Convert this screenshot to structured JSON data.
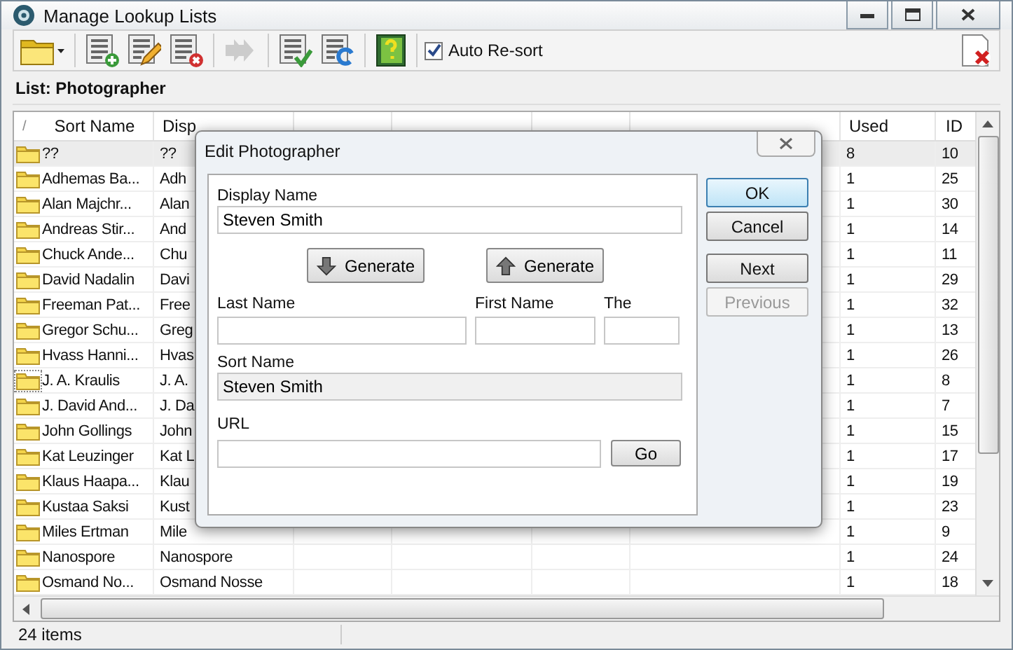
{
  "window": {
    "title": "Manage Lookup Lists"
  },
  "toolbar": {
    "auto_resort": {
      "label": "Auto Re-sort",
      "checked": true
    }
  },
  "list_label": "List: Photographer",
  "table": {
    "columns": [
      {
        "label": "/"
      },
      {
        "label": "Sort Name"
      },
      {
        "label": "Disp"
      },
      {
        "label": "Used"
      },
      {
        "label": "ID"
      }
    ],
    "rows": [
      {
        "sort_name": "??",
        "display_name": "??",
        "used": "8",
        "id": "10",
        "selected": true,
        "focused": false
      },
      {
        "sort_name": "Adhemas Ba...",
        "display_name": "Adh",
        "used": "1",
        "id": "25",
        "selected": false,
        "focused": false
      },
      {
        "sort_name": "Alan Majchr...",
        "display_name": "Alan",
        "used": "1",
        "id": "30",
        "selected": false,
        "focused": false
      },
      {
        "sort_name": "Andreas Stir...",
        "display_name": "And",
        "used": "1",
        "id": "14",
        "selected": false,
        "focused": false
      },
      {
        "sort_name": "Chuck Ande...",
        "display_name": "Chu",
        "used": "1",
        "id": "11",
        "selected": false,
        "focused": false
      },
      {
        "sort_name": "David Nadalin",
        "display_name": "Davi",
        "used": "1",
        "id": "29",
        "selected": false,
        "focused": false
      },
      {
        "sort_name": "Freeman Pat...",
        "display_name": "Free",
        "used": "1",
        "id": "32",
        "selected": false,
        "focused": false
      },
      {
        "sort_name": "Gregor Schu...",
        "display_name": "Greg",
        "used": "1",
        "id": "13",
        "selected": false,
        "focused": false
      },
      {
        "sort_name": "Hvass Hanni...",
        "display_name": "Hvas",
        "used": "1",
        "id": "26",
        "selected": false,
        "focused": false
      },
      {
        "sort_name": "J. A. Kraulis",
        "display_name": "J. A.",
        "used": "1",
        "id": "8",
        "selected": false,
        "focused": true
      },
      {
        "sort_name": "J. David And...",
        "display_name": "J. Da",
        "used": "1",
        "id": "7",
        "selected": false,
        "focused": false
      },
      {
        "sort_name": "John Gollings",
        "display_name": "John",
        "used": "1",
        "id": "15",
        "selected": false,
        "focused": false
      },
      {
        "sort_name": "Kat Leuzinger",
        "display_name": "Kat L",
        "used": "1",
        "id": "17",
        "selected": false,
        "focused": false
      },
      {
        "sort_name": "Klaus Haapa...",
        "display_name": "Klau",
        "used": "1",
        "id": "19",
        "selected": false,
        "focused": false
      },
      {
        "sort_name": "Kustaa Saksi",
        "display_name": "Kust",
        "used": "1",
        "id": "23",
        "selected": false,
        "focused": false
      },
      {
        "sort_name": "Miles Ertman",
        "display_name": "Mile",
        "used": "1",
        "id": "9",
        "selected": false,
        "focused": false
      },
      {
        "sort_name": "Nanospore",
        "display_name": "Nanospore",
        "used": "1",
        "id": "24",
        "selected": false,
        "focused": false
      },
      {
        "sort_name": "Osmand No...",
        "display_name": "Osmand Nosse",
        "used": "1",
        "id": "18",
        "selected": false,
        "focused": false
      }
    ]
  },
  "status_bar": {
    "count": "24 items"
  },
  "dialog": {
    "title": "Edit  Photographer",
    "display_name": {
      "label": "Display Name",
      "value": "Steven Smith"
    },
    "generate_buttons": [
      {
        "label": "Generate",
        "kind": "down"
      },
      {
        "label": "Generate",
        "kind": "up"
      }
    ],
    "last_name": {
      "label": "Last Name"
    },
    "first_name": {
      "label": "First Name"
    },
    "the": {
      "label": "The"
    },
    "sort_name": {
      "label": "Sort Name",
      "value": "Steven Smith"
    },
    "url": {
      "label": "URL"
    },
    "go_button": "Go",
    "side_buttons": [
      {
        "label": "OK",
        "disabled": false,
        "default": true
      },
      {
        "label": "Cancel",
        "disabled": false,
        "default": false
      },
      {
        "label": "Next",
        "disabled": false,
        "default": false
      },
      {
        "label": "Previous",
        "disabled": true,
        "default": false
      }
    ]
  }
}
